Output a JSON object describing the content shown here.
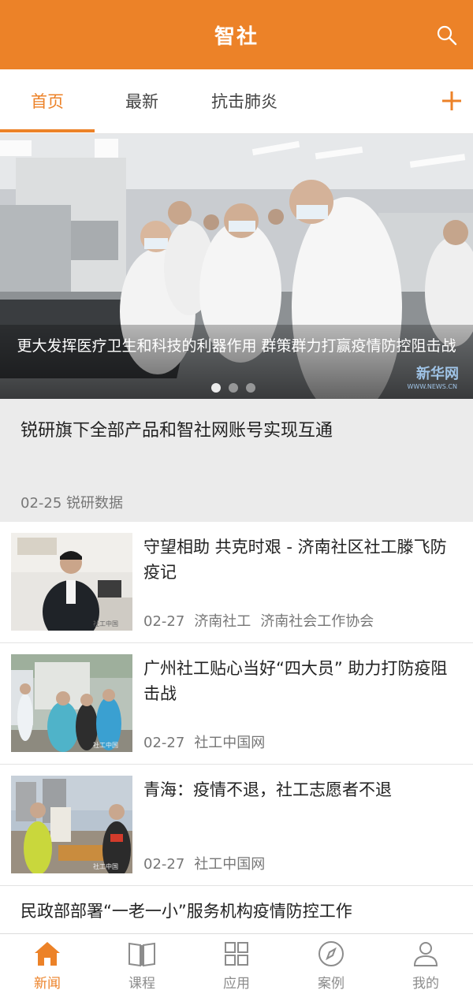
{
  "header": {
    "title": "智社",
    "search_icon": "search-icon",
    "bg_color": "#ec8228"
  },
  "tabs": [
    {
      "label": "首页",
      "active": true
    },
    {
      "label": "最新",
      "active": false
    },
    {
      "label": "抗击肺炎",
      "active": false
    }
  ],
  "tab_add_icon": "plus-icon",
  "banner": {
    "caption": "更大发挥医疗卫生和科技的利器作用 群策群力打赢疫情防控阻击战",
    "watermark": "新华网",
    "watermark_sub": "WWW.NEWS.CN",
    "slides_total": 3,
    "active_slide": 1
  },
  "notice": {
    "title": "锐研旗下全部产品和智社网账号实现互通",
    "date": "02-25",
    "source": "锐研数据"
  },
  "news": [
    {
      "title": "守望相助 共克时艰 - 济南社区社工滕飞防疫记",
      "date": "02-27",
      "sources": [
        "济南社工",
        "济南社会工作协会"
      ],
      "thumb_watermark": "社工中国"
    },
    {
      "title": "广州社工贴心当好“四大员” 助力打防疫阻击战",
      "date": "02-27",
      "sources": [
        "社工中国网"
      ],
      "thumb_watermark": "社工中国"
    },
    {
      "title": "青海：疫情不退，社工志愿者不退",
      "date": "02-27",
      "sources": [
        "社工中国网"
      ],
      "thumb_watermark": "社工中国"
    }
  ],
  "news_last": {
    "title": "民政部部署“一老一小”服务机构疫情防控工作"
  },
  "bottom_nav": [
    {
      "label": "新闻",
      "icon": "home-icon",
      "active": true
    },
    {
      "label": "课程",
      "icon": "book-icon",
      "active": false
    },
    {
      "label": "应用",
      "icon": "grid-icon",
      "active": false
    },
    {
      "label": "案例",
      "icon": "compass-icon",
      "active": false
    },
    {
      "label": "我的",
      "icon": "user-icon",
      "active": false
    }
  ],
  "colors": {
    "accent": "#ec8228",
    "inactive": "#8c8c8c",
    "notice_bg": "#ebebeb"
  }
}
